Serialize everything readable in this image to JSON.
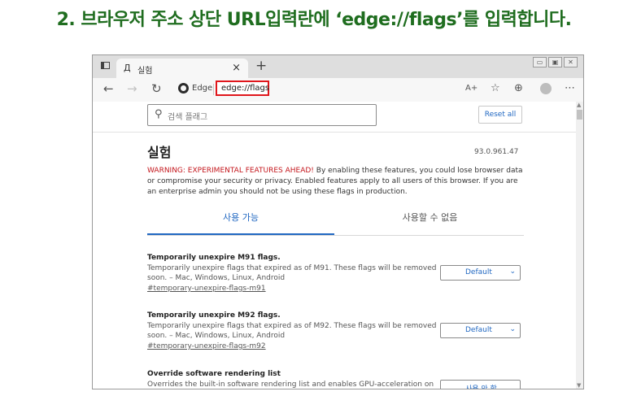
{
  "instruction": "2. 브라우저 주소 상단 URL입력란에 ‘edge://flags’를 입력합니다.",
  "browser": {
    "tab_icon": "Д",
    "tab_title": "실험",
    "tab_close": "×",
    "new_tab": "+",
    "window_controls": [
      "▭",
      "▣",
      "✕"
    ],
    "nav": {
      "back": "←",
      "forward": "→",
      "refresh": "↻"
    },
    "site_label": "Edge",
    "url": "edge://flags",
    "toolbar_icons": [
      "read-aloud-icon",
      "favorites-icon",
      "collections-icon",
      "profile-icon",
      "more-icon"
    ],
    "toolbar_glyphs": [
      "A+",
      "☆",
      "⊕",
      "",
      "⋯"
    ]
  },
  "page": {
    "search_placeholder": "검색 플래그",
    "reset_label": "Reset all",
    "title": "실험",
    "version": "93.0.961.47",
    "warning_red": "WARNING: EXPERIMENTAL FEATURES AHEAD!",
    "warning_text": " By enabling these features, you could lose browser data or compromise your security or privacy. Enabled features apply to all users of this browser. If you are an enterprise admin you should not be using these flags in production.",
    "tab_available": "사용 가능",
    "tab_unavailable": "사용할 수 없음",
    "flags": [
      {
        "title": "Temporarily unexpire M91 flags.",
        "description": "Temporarily unexpire flags that expired as of M91. These flags will be removed soon. – Mac, Windows, Linux, Android",
        "link": "#temporary-unexpire-flags-m91",
        "value": "Default"
      },
      {
        "title": "Temporarily unexpire M92 flags.",
        "description": "Temporarily unexpire flags that expired as of M92. These flags will be removed soon. – Mac, Windows, Linux, Android",
        "link": "#temporary-unexpire-flags-m92",
        "value": "Default"
      },
      {
        "title": "Override software rendering list",
        "description": "Overrides the built-in software rendering list and enables GPU-acceleration on unsupported",
        "link": "",
        "value": "사용 안 함"
      }
    ]
  }
}
